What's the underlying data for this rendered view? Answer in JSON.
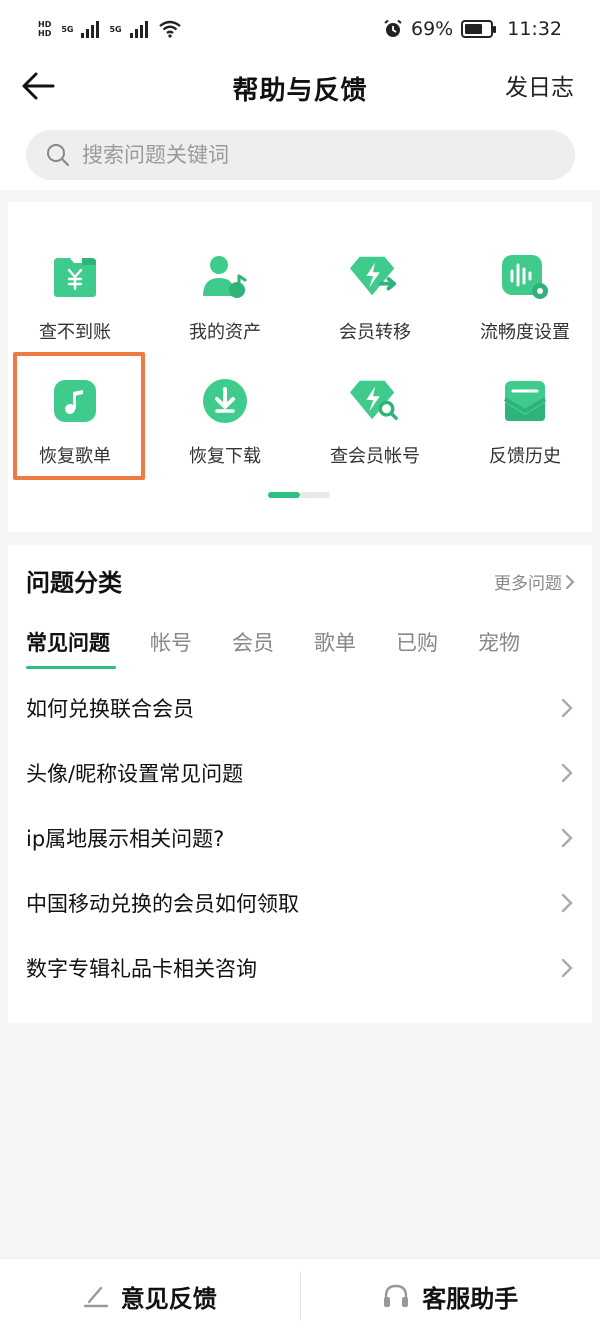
{
  "status": {
    "sim1": "HD",
    "sim2": "HD",
    "net1": "5G",
    "net2": "5G",
    "battery": "69%",
    "time": "11:32"
  },
  "header": {
    "title": "帮助与反馈",
    "right": "发日志"
  },
  "search": {
    "placeholder": "搜索问题关键词"
  },
  "tools": [
    {
      "label": "查不到账",
      "icon": "yen-folder-icon"
    },
    {
      "label": "我的资产",
      "icon": "user-assets-icon"
    },
    {
      "label": "会员转移",
      "icon": "vip-transfer-icon"
    },
    {
      "label": "流畅度设置",
      "icon": "smooth-settings-icon"
    },
    {
      "label": "恢复歌单",
      "icon": "music-note-icon"
    },
    {
      "label": "恢复下载",
      "icon": "download-icon"
    },
    {
      "label": "查会员帐号",
      "icon": "vip-search-icon"
    },
    {
      "label": "反馈历史",
      "icon": "feedback-history-icon"
    }
  ],
  "pager": {
    "current": 1,
    "total": 2
  },
  "categories": {
    "title": "问题分类",
    "more": "更多问题",
    "tabs": [
      "常见问题",
      "帐号",
      "会员",
      "歌单",
      "已购",
      "宠物"
    ],
    "active_tab": 0,
    "questions": [
      "如何兑换联合会员",
      "头像/昵称设置常见问题",
      "ip属地展示相关问题?",
      "中国移动兑换的会员如何领取",
      "数字专辑礼品卡相关咨询"
    ]
  },
  "bottom": {
    "feedback": "意见反馈",
    "service": "客服助手"
  },
  "colors": {
    "accent": "#2fbf80",
    "highlight": "#f07a43"
  }
}
